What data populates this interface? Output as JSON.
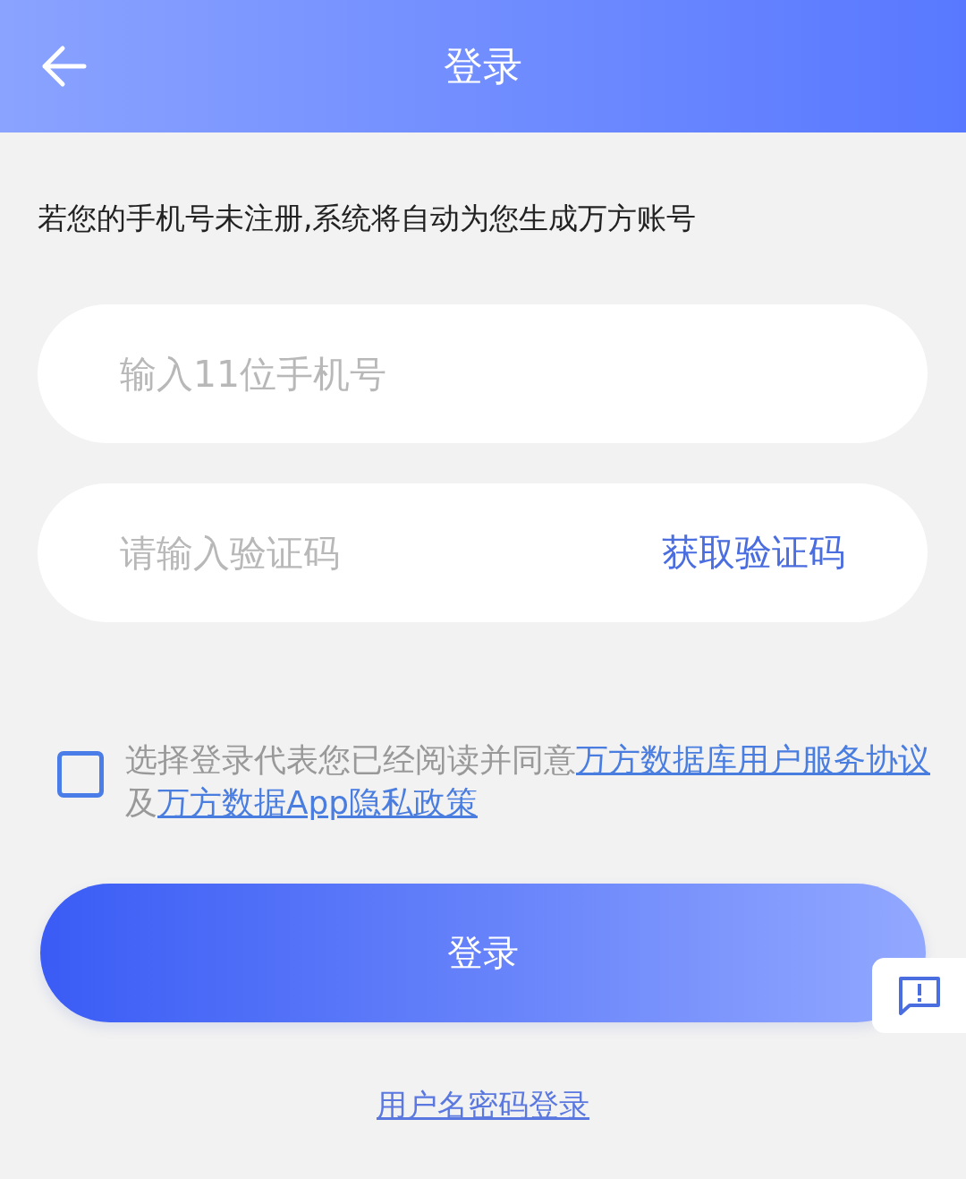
{
  "header": {
    "title": "登录"
  },
  "notice": "若您的手机号未注册,系统将自动为您生成万方账号",
  "phone_field": {
    "placeholder": "输入11位手机号"
  },
  "code_field": {
    "placeholder": "请输入验证码",
    "action": "获取验证码"
  },
  "agreement": {
    "checked": false,
    "parts": [
      {
        "kind": "text",
        "text": "选择登录代表您已经阅读并同意"
      },
      {
        "kind": "link",
        "text": "万方数据库用户服务协议"
      },
      {
        "kind": "text",
        "text": "及"
      },
      {
        "kind": "link",
        "text": "万方数据App隐私政策"
      }
    ]
  },
  "login_button": "登录",
  "alt_login": "用户名密码登录"
}
